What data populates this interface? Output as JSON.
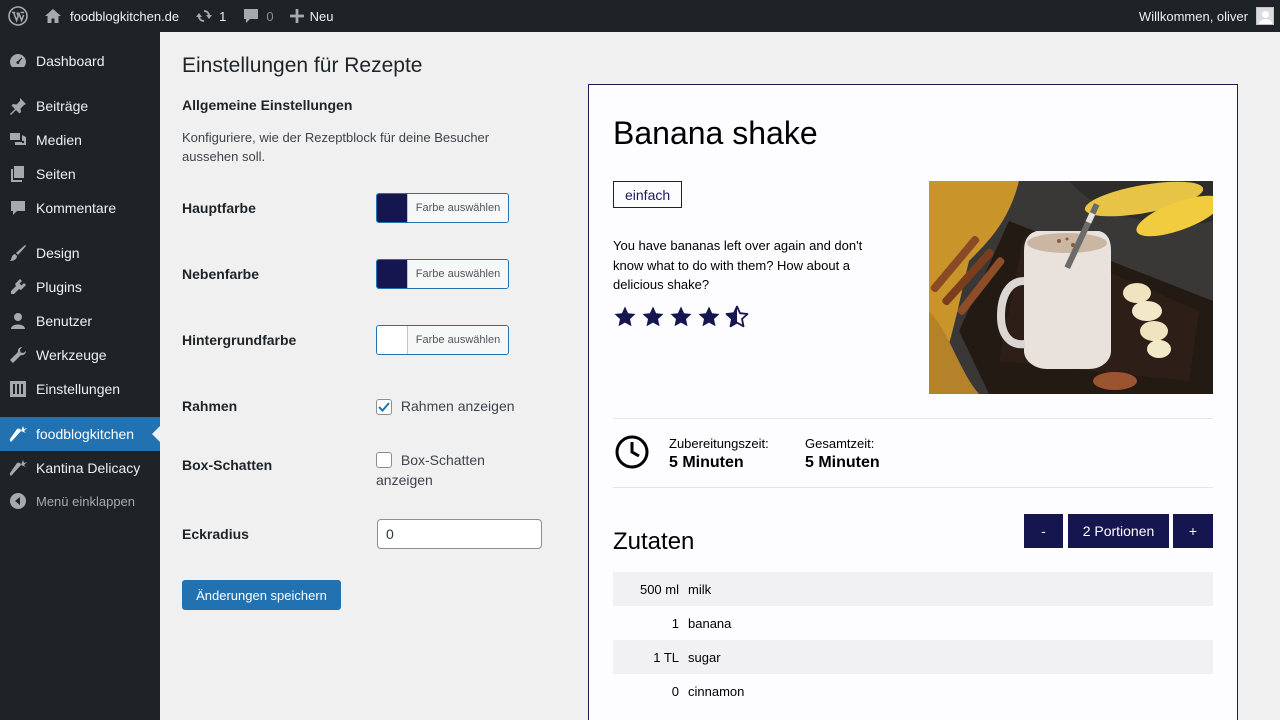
{
  "adminbar": {
    "site_name": "foodblogkitchen.de",
    "updates_count": "1",
    "comments_count": "0",
    "new_label": "Neu",
    "welcome": "Willkommen, oliver"
  },
  "sidebar": {
    "items": [
      {
        "label": "Dashboard",
        "icon": "dashboard-icon"
      },
      {
        "label": "Beiträge",
        "icon": "pin-icon"
      },
      {
        "label": "Medien",
        "icon": "media-icon"
      },
      {
        "label": "Seiten",
        "icon": "pages-icon"
      },
      {
        "label": "Kommentare",
        "icon": "comment-icon"
      },
      {
        "label": "Design",
        "icon": "brush-icon"
      },
      {
        "label": "Plugins",
        "icon": "plugin-icon"
      },
      {
        "label": "Benutzer",
        "icon": "user-icon"
      },
      {
        "label": "Werkzeuge",
        "icon": "wrench-icon"
      },
      {
        "label": "Einstellungen",
        "icon": "settings-icon"
      },
      {
        "label": "foodblogkitchen",
        "icon": "carrot-icon",
        "active": true
      },
      {
        "label": "Kantina Delicacy",
        "icon": "carrot-icon"
      },
      {
        "label": "Menü einklappen",
        "icon": "collapse-icon"
      }
    ]
  },
  "settings": {
    "page_title": "Einstellungen für Rezepte",
    "section_title": "Allgemeine Einstellungen",
    "description": "Konfiguriere, wie der Rezeptblock für deine Besucher aussehen soll.",
    "main_color_label": "Hauptfarbe",
    "main_color_value": "#15154f",
    "secondary_color_label": "Nebenfarbe",
    "secondary_color_value": "#15154f",
    "background_color_label": "Hintergrundfarbe",
    "background_color_value": "#ffffff",
    "choose_color": "Farbe auswählen",
    "border_label": "Rahmen",
    "border_checkbox": "Rahmen anzeigen",
    "border_checked": true,
    "shadow_label": "Box-Schatten",
    "shadow_checkbox": "Box-Schatten anzeigen",
    "shadow_checked": false,
    "radius_label": "Eckradius",
    "radius_value": "0",
    "save_button": "Änderungen speichern"
  },
  "preview": {
    "title": "Banana shake",
    "difficulty": "einfach",
    "description": "You have bananas left over again and don't know what to do with them? How about a delicious shake?",
    "rating": 4.5,
    "rating_max": 5,
    "prep_time_label": "Zubereitungszeit:",
    "prep_time_value": "5 Minuten",
    "total_time_label": "Gesamtzeit:",
    "total_time_value": "5 Minuten",
    "ingredients_title": "Zutaten",
    "servings_minus": "-",
    "servings_label": "2 Portionen",
    "servings_plus": "+",
    "ingredients": [
      {
        "qty": "500 ml",
        "name": "milk"
      },
      {
        "qty": "1",
        "name": "banana"
      },
      {
        "qty": "1 TL",
        "name": "sugar"
      },
      {
        "qty": "0",
        "name": "cinnamon"
      }
    ]
  }
}
